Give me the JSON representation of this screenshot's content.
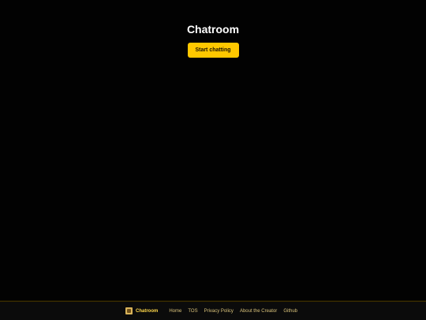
{
  "hero": {
    "title": "Chatroom",
    "start_button_label": "Start chatting"
  },
  "footer": {
    "brand_name": "Chatroom",
    "links": [
      {
        "label": "Home"
      },
      {
        "label": "TOS"
      },
      {
        "label": "Privacy Policy"
      },
      {
        "label": "About the Creator"
      },
      {
        "label": "Github"
      }
    ]
  },
  "colors": {
    "background": "#020202",
    "accent": "#ffc800",
    "footer_link": "#d9c27a"
  }
}
